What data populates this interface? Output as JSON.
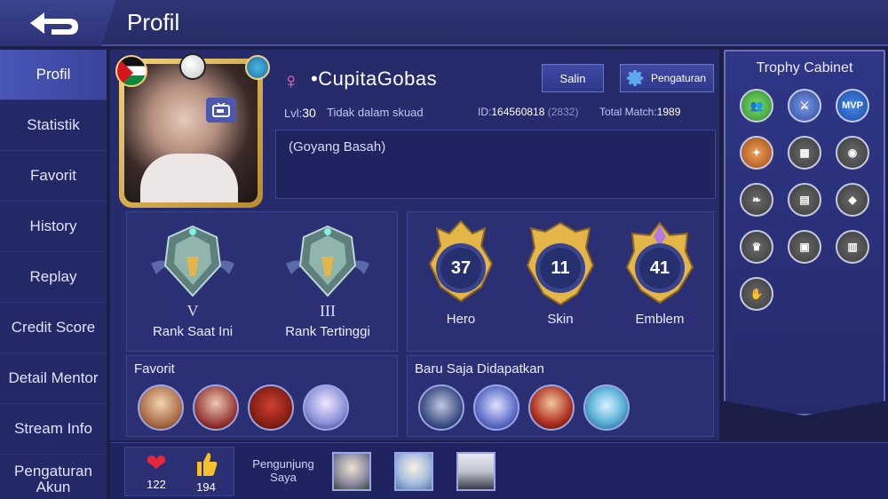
{
  "header": {
    "title": "Profil",
    "back_icon": "back-arrow-icon"
  },
  "sidebar": {
    "items": [
      {
        "label": "Profil",
        "active": true
      },
      {
        "label": "Statistik"
      },
      {
        "label": "Favorit"
      },
      {
        "label": "History"
      },
      {
        "label": "Replay"
      },
      {
        "label": "Credit Score"
      },
      {
        "label": "Detail Mentor"
      },
      {
        "label": "Stream Info"
      },
      {
        "label": "Pengaturan Akun"
      }
    ]
  },
  "profile": {
    "name": "•CupitaGobas",
    "gender_icon": "female-icon",
    "level_label": "Lvl:",
    "level": "30",
    "squad": "Tidak dalam skuad",
    "id_label": "ID:",
    "id": "164560818",
    "server": "(2832)",
    "total_match_label": "Total Match:",
    "total_match": "1989",
    "bio": "(Goyang Basah)",
    "copy_button": "Salin",
    "settings_button": "Pengaturan"
  },
  "rank": {
    "current": {
      "tier": "V",
      "label": "Rank Saat Ini"
    },
    "highest": {
      "tier": "III",
      "label": "Rank Tertinggi"
    }
  },
  "collection": {
    "hero": {
      "count": "37",
      "label": "Hero"
    },
    "skin": {
      "count": "11",
      "label": "Skin"
    },
    "emblem": {
      "count": "41",
      "label": "Emblem"
    }
  },
  "favorites": {
    "title": "Favorit"
  },
  "recent": {
    "title": "Baru Saja Didapatkan"
  },
  "trophy": {
    "title": "Trophy Cabinet",
    "items": [
      "friends-trophy-icon",
      "shield-trophy-icon",
      "MVP",
      "wings-trophy-icon",
      "locked-trophy-icon",
      "locked-eye-trophy-icon",
      "locked-feather-trophy-icon",
      "locked-cards-trophy-icon",
      "locked-gem-trophy-icon",
      "locked-cup-trophy-icon",
      "locked-book-trophy-icon",
      "locked-chart-trophy-icon",
      "locked-hand-trophy-icon"
    ]
  },
  "stats": {
    "likes": "122",
    "thumbs": "194"
  },
  "visitors": {
    "label": "Pengunjung Saya"
  },
  "colors": {
    "accent": "#4a56b8",
    "gold": "#e4b64a",
    "female": "#ff6fb8"
  }
}
